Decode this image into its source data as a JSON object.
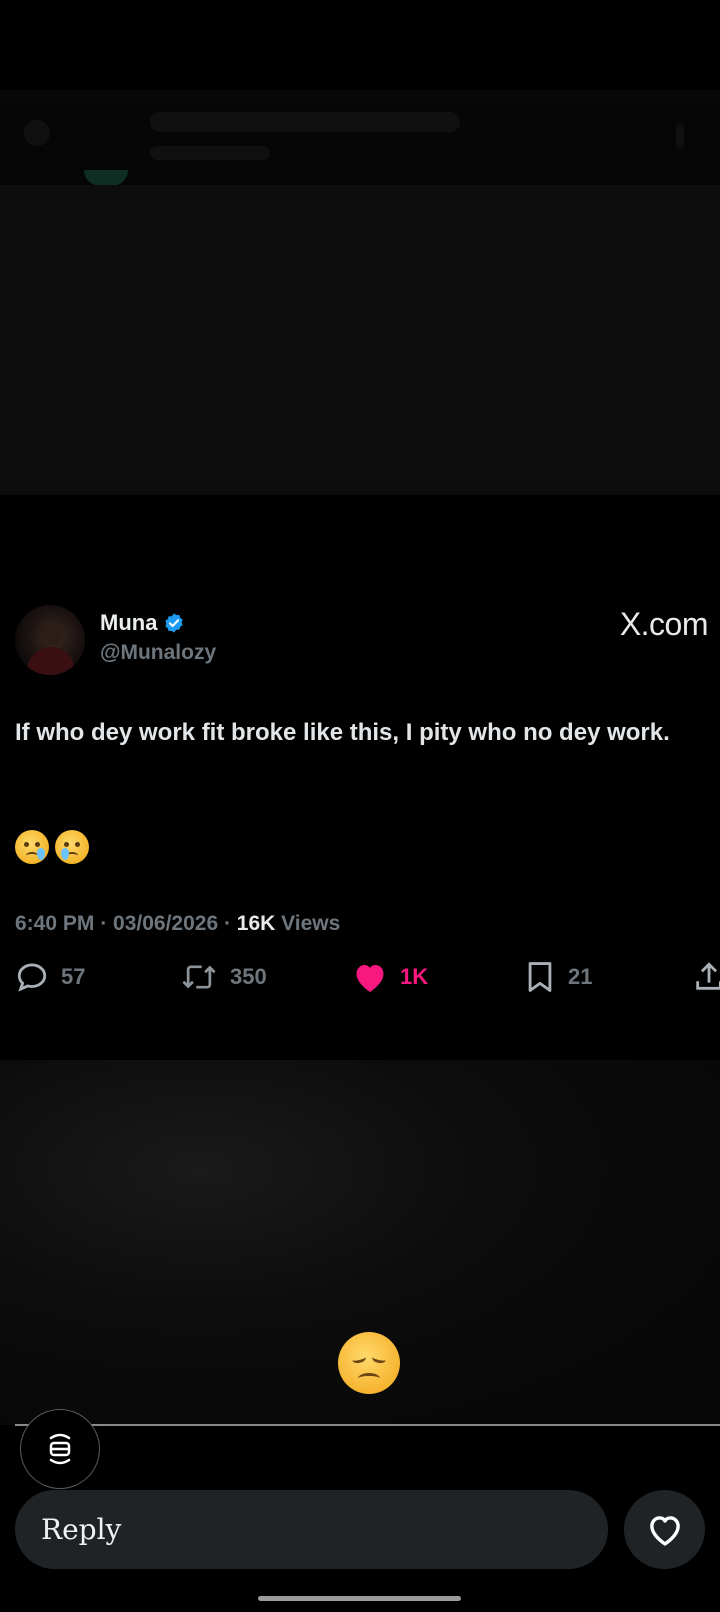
{
  "tweet": {
    "display_name": "Muna",
    "handle": "@Munalozy",
    "source": "X.com",
    "text": "If who dey work fit broke like this, I pity who no dey work.",
    "emojis": [
      "sad-but-relieved-face",
      "crying-face"
    ],
    "time": "6:40 PM · 03/06/2026 · ",
    "views_count": "16K",
    "views_label": " Views",
    "replies": "57",
    "reposts": "350",
    "likes": "1K",
    "bookmarks": "21"
  },
  "story": {
    "reaction_emoji": "disappointed-face",
    "progress_fraction": 0.0
  },
  "composer": {
    "placeholder": "Reply"
  },
  "colors": {
    "like": "#f91880",
    "verified": "#1d9bf0",
    "muted": "#6e767d"
  }
}
